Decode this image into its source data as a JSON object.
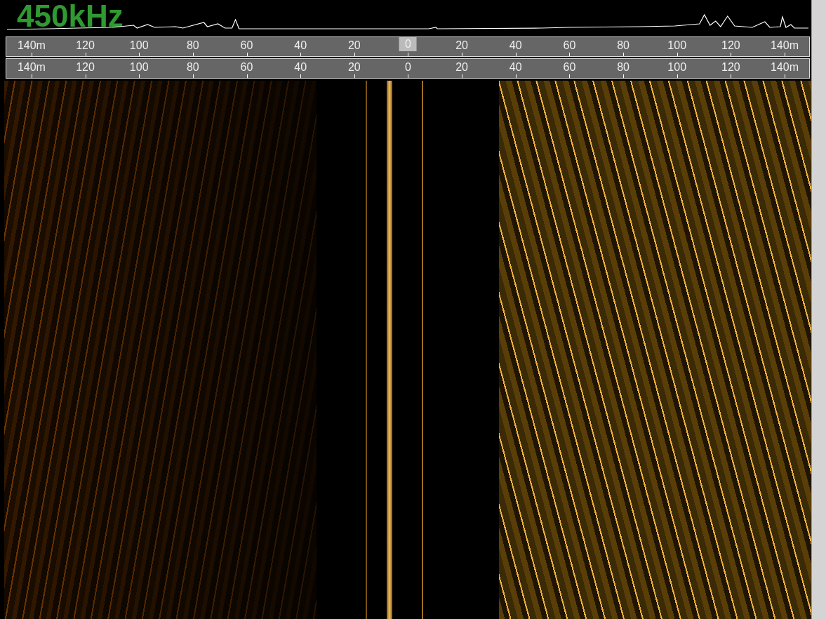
{
  "frequency": "450kHz",
  "scales": [
    {
      "ticks": [
        {
          "text": "140m",
          "selected": false
        },
        {
          "text": "120",
          "selected": false
        },
        {
          "text": "100",
          "selected": false
        },
        {
          "text": "80",
          "selected": false
        },
        {
          "text": "60",
          "selected": false
        },
        {
          "text": "40",
          "selected": false
        },
        {
          "text": "20",
          "selected": false
        },
        {
          "text": "0",
          "selected": true
        },
        {
          "text": "20",
          "selected": false
        },
        {
          "text": "40",
          "selected": false
        },
        {
          "text": "60",
          "selected": false
        },
        {
          "text": "80",
          "selected": false
        },
        {
          "text": "100",
          "selected": false
        },
        {
          "text": "120",
          "selected": false
        },
        {
          "text": "140m",
          "selected": false
        }
      ]
    },
    {
      "ticks": [
        {
          "text": "140m",
          "selected": false
        },
        {
          "text": "120",
          "selected": false
        },
        {
          "text": "100",
          "selected": false
        },
        {
          "text": "80",
          "selected": false
        },
        {
          "text": "60",
          "selected": false
        },
        {
          "text": "40",
          "selected": false
        },
        {
          "text": "20",
          "selected": false
        },
        {
          "text": "0",
          "selected": false
        },
        {
          "text": "20",
          "selected": false
        },
        {
          "text": "40",
          "selected": false
        },
        {
          "text": "60",
          "selected": false
        },
        {
          "text": "80",
          "selected": false
        },
        {
          "text": "100",
          "selected": false
        },
        {
          "text": "120",
          "selected": false
        },
        {
          "text": "140m",
          "selected": false
        }
      ]
    }
  ]
}
